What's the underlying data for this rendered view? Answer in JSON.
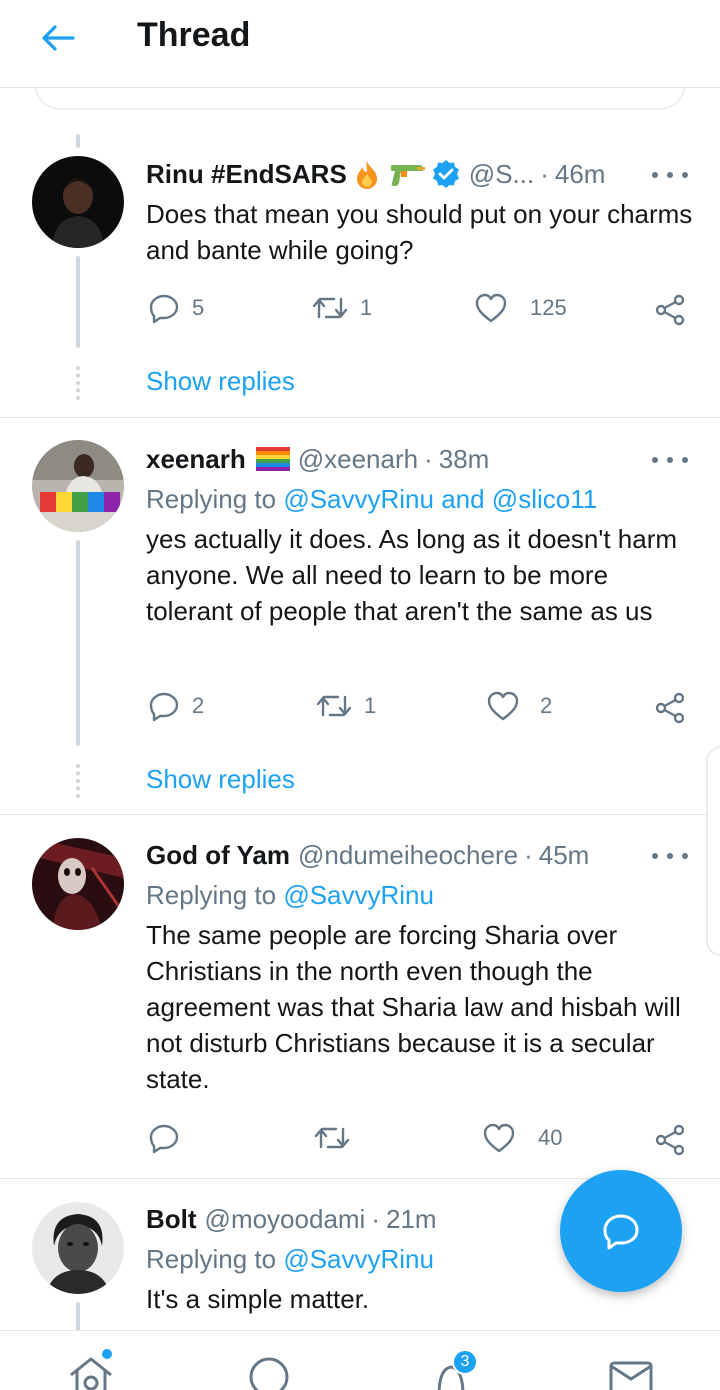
{
  "header": {
    "title": "Thread"
  },
  "tweets": [
    {
      "display_name": "Rinu #EndSARS",
      "handle": "@S...",
      "time": "46m",
      "replying_to": "",
      "body": "Does that mean you should put on your charms and bante while going?",
      "reply_count": "5",
      "retweet_count": "1",
      "like_count": "125",
      "show_replies": "Show replies"
    },
    {
      "display_name": "xeenarh",
      "handle": "@xeenarh",
      "time": "38m",
      "replying_to_prefix": "Replying to",
      "replying_to": "@SavvyRinu and @slico11",
      "body": "yes actually it does. As long as it doesn't harm anyone. We all need to learn to be more tolerant of people that aren't the same as us",
      "reply_count": "2",
      "retweet_count": "1",
      "like_count": "2",
      "show_replies": "Show replies"
    },
    {
      "display_name": "God of Yam",
      "handle": "@ndumeiheochere",
      "time": "45m",
      "replying_to_prefix": "Replying to",
      "replying_to": "@SavvyRinu",
      "body": "The same people are forcing Sharia over Christians in the north even though the agreement was that Sharia law and hisbah will not disturb Christians because it is a secular state.",
      "reply_count": "",
      "retweet_count": "",
      "like_count": "40"
    },
    {
      "display_name": "Bolt",
      "handle": "@moyoodami",
      "time": "21m",
      "replying_to_prefix": "Replying to",
      "replying_to": "@SavvyRinu",
      "body": "It's a simple matter."
    }
  ],
  "bottom_nav": {
    "items": [
      "home-icon",
      "search-icon",
      "notifications-icon",
      "messages-icon"
    ],
    "notification_count": "3"
  },
  "colors": {
    "accent": "#1da1f2",
    "text": "#14171a",
    "secondary": "#657786",
    "line": "#ced5db"
  }
}
